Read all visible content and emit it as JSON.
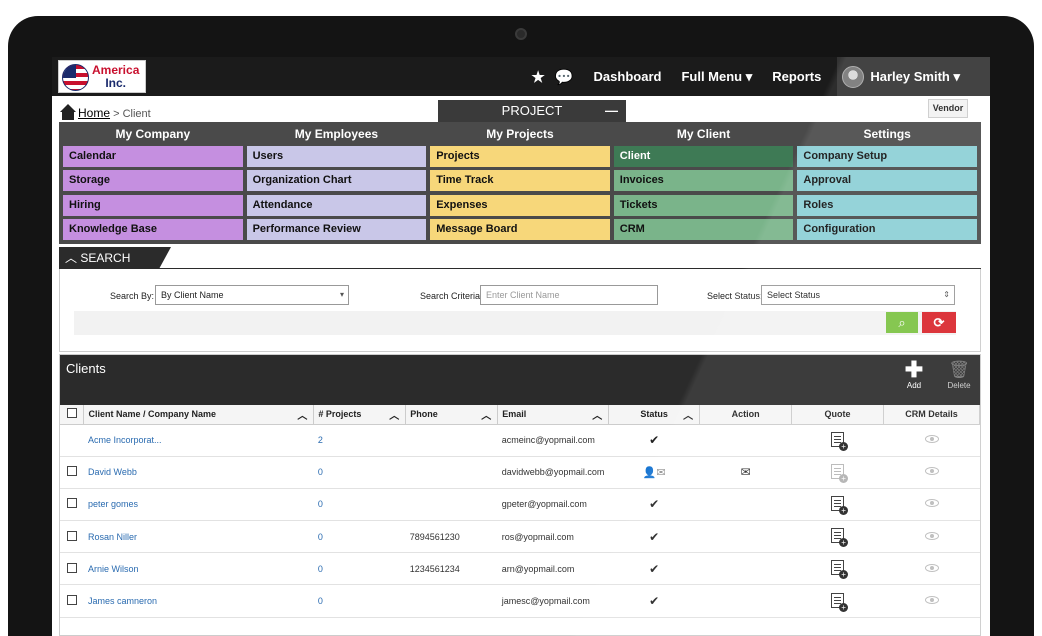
{
  "logo": {
    "line1": "America",
    "line2": "Inc."
  },
  "topnav": {
    "items": [
      "Dashboard",
      "Full Menu ▾",
      "Reports"
    ],
    "user": "Harley Smith ▾"
  },
  "breadcrumb": {
    "home": "Home",
    "sep": " > ",
    "current": "Client"
  },
  "project_tab": {
    "label": "PROJECT",
    "toggle": "—"
  },
  "vendor_label": "Vendor",
  "menu": {
    "columns": [
      {
        "title": "My Company",
        "items": [
          "Calendar",
          "Storage",
          "Hiring",
          "Knowledge Base"
        ]
      },
      {
        "title": "My Employees",
        "items": [
          "Users",
          "Organization Chart",
          "Attendance",
          "Performance Review"
        ]
      },
      {
        "title": "My Projects",
        "items": [
          "Projects",
          "Time Track",
          "Expenses",
          "Message Board"
        ]
      },
      {
        "title": "My Client",
        "items": [
          "Client",
          "Invoices",
          "Tickets",
          "CRM"
        ]
      },
      {
        "title": "Settings",
        "items": [
          "Company Setup",
          "Approval",
          "Roles",
          "Configuration"
        ]
      }
    ]
  },
  "search": {
    "header": "SEARCH",
    "search_by_label": "Search By:",
    "search_by_value": "By Client Name",
    "criteria_label": "Search Criteria:",
    "criteria_placeholder": "Enter Client Name",
    "status_label": "Select Status:",
    "status_value": "Select Status"
  },
  "clients": {
    "title": "Clients",
    "add_label": "Add",
    "delete_label": "Delete",
    "columns": [
      "Client Name / Company Name",
      "# Projects",
      "Phone",
      "Email",
      "Status",
      "Action",
      "Quote",
      "CRM Details"
    ],
    "rows": [
      {
        "name": "Acme Incorporat...",
        "projects": "2",
        "phone": "",
        "email": "acmeinc@yopmail.com"
      },
      {
        "name": "David Webb",
        "projects": "0",
        "phone": "",
        "email": "davidwebb@yopmail.com"
      },
      {
        "name": "peter gomes",
        "projects": "0",
        "phone": "",
        "email": "gpeter@yopmail.com"
      },
      {
        "name": "Rosan Niller",
        "projects": "0",
        "phone": "7894561230",
        "email": "ros@yopmail.com"
      },
      {
        "name": "Arnie Wilson",
        "projects": "0",
        "phone": "1234561234",
        "email": "arn@yopmail.com"
      },
      {
        "name": "James camneron",
        "projects": "0",
        "phone": "",
        "email": "jamesc@yopmail.com"
      }
    ]
  },
  "colors": {
    "topbar": "#1b1b1b",
    "purple": "#c58fe0",
    "lavender": "#c9c7e8",
    "yellow": "#f7d77a",
    "green": "#7ab48a",
    "teal": "#8ccfd6",
    "search_button": "#7cc242",
    "reset_button": "#d9252b",
    "link": "#2a6bb0"
  }
}
